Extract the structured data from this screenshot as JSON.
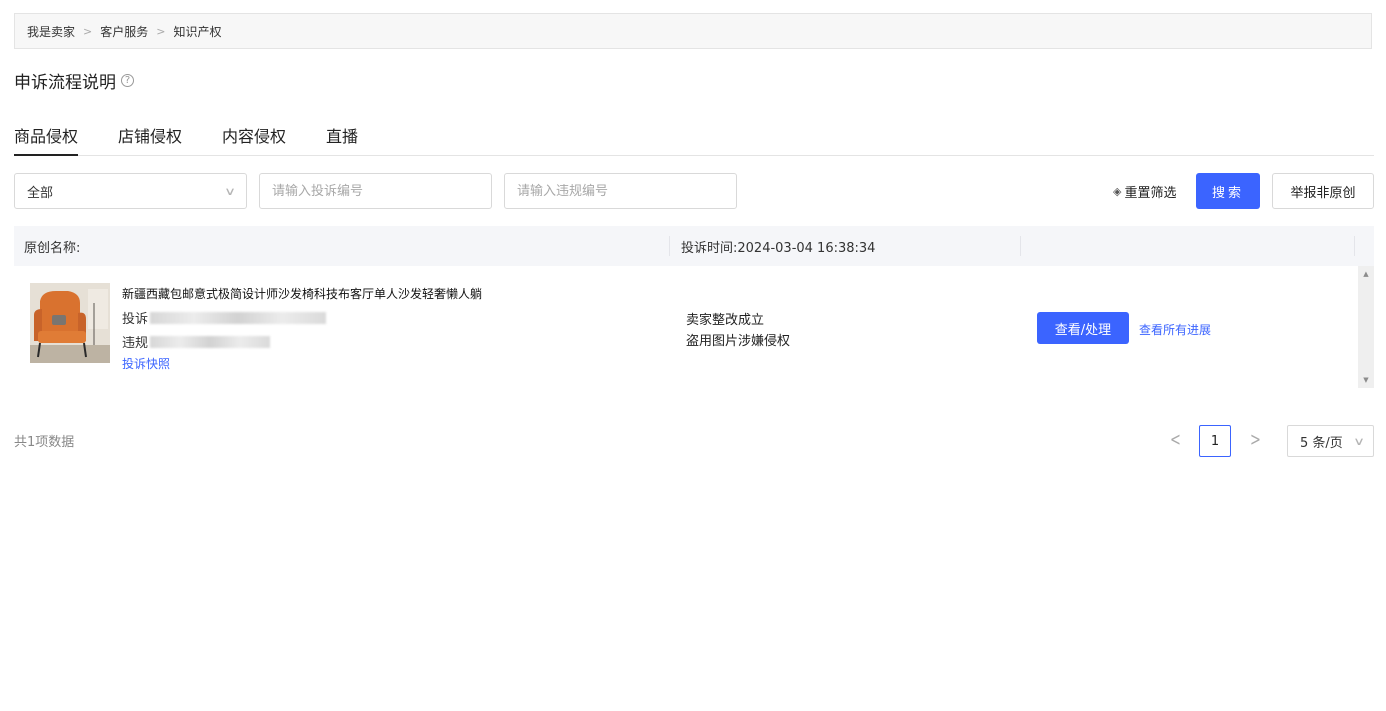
{
  "breadcrumb": [
    "我是卖家",
    "客户服务",
    "知识产权"
  ],
  "breadcrumb_separator": ">",
  "page_title": "申诉流程说明",
  "tabs": [
    {
      "label": "商品侵权",
      "active": true
    },
    {
      "label": "店铺侵权",
      "active": false
    },
    {
      "label": "内容侵权",
      "active": false
    },
    {
      "label": "直播",
      "active": false
    }
  ],
  "filters": {
    "status_select_value": "全部",
    "complaint_no_placeholder": "请输入投诉编号",
    "violation_no_placeholder": "请输入违规编号",
    "reset_label": "重置筛选",
    "search_label": "搜索",
    "report_label": "举报非原创"
  },
  "table": {
    "col_original_name": "原创名称:",
    "col_complaint_time": "投诉时间:2024-03-04 16:38:34",
    "rows": [
      {
        "product_title": "新疆西藏包邮意式极简设计师沙发椅科技布客厅单人沙发轻奢懒人躺",
        "complaint_prefix": "投诉",
        "violation_prefix": "违规",
        "snapshot_link": "投诉快照",
        "status": "卖家整改成立",
        "reason": "盗用图片涉嫌侵权",
        "action_button": "查看/处理",
        "progress_link": "查看所有进展"
      }
    ]
  },
  "pagination": {
    "total_text": "共1项数据",
    "current_page": "1",
    "page_size": "5 条/页"
  },
  "colors": {
    "accent": "#3b64ff",
    "header_bg": "#f5f6f9",
    "chair": "#d9722f"
  },
  "icons": {
    "help": "question-circle-icon",
    "eraser": "eraser-icon",
    "chevron": "chevron-down-icon"
  }
}
